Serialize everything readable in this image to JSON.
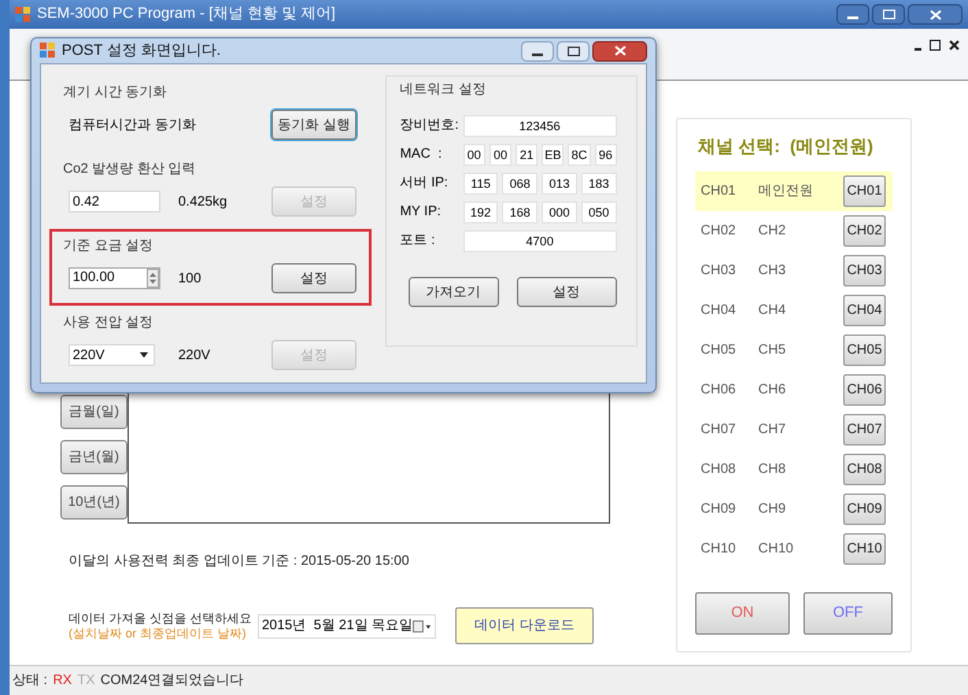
{
  "app": {
    "title": "SEM-3000 PC Program - [채널 현황 및 제어]"
  },
  "period_buttons": [
    "금월(일)",
    "금년(월)",
    "10년(년)"
  ],
  "update_notice": "이달의 사용전력 최종 업데이트 기준 : 2015-05-20 15:00",
  "download": {
    "prompt": "데이터 가져올 싯점을 선택하세요",
    "hint": "(설치날짜 or 최종업데이트 날짜)",
    "date": "2015년  5월 21일 목요일",
    "button": "데이터 다운로드"
  },
  "channel_panel": {
    "title": "채널 선택:  (메인전원)",
    "channels": [
      {
        "id": "CH01",
        "name": "메인전원",
        "button": "CH01",
        "selected": true
      },
      {
        "id": "CH02",
        "name": "CH2",
        "button": "CH02",
        "selected": false
      },
      {
        "id": "CH03",
        "name": "CH3",
        "button": "CH03",
        "selected": false
      },
      {
        "id": "CH04",
        "name": "CH4",
        "button": "CH04",
        "selected": false
      },
      {
        "id": "CH05",
        "name": "CH5",
        "button": "CH05",
        "selected": false
      },
      {
        "id": "CH06",
        "name": "CH6",
        "button": "CH06",
        "selected": false
      },
      {
        "id": "CH07",
        "name": "CH7",
        "button": "CH07",
        "selected": false
      },
      {
        "id": "CH08",
        "name": "CH8",
        "button": "CH08",
        "selected": false
      },
      {
        "id": "CH09",
        "name": "CH9",
        "button": "CH09",
        "selected": false
      },
      {
        "id": "CH10",
        "name": "CH10",
        "button": "CH10",
        "selected": false
      }
    ],
    "on_button": "ON",
    "off_button": "OFF"
  },
  "status_bar": {
    "label": "상태 :",
    "rx": {
      "text": "RX",
      "on": true
    },
    "tx": {
      "text": "TX",
      "on": false
    },
    "message": "COM24연결되었습니다"
  },
  "dialog": {
    "title": "POST 설정 화면입니다.",
    "groups": [
      {
        "kind": "sync",
        "title": "계기 시간 동기화",
        "label": "컴퓨터시간과 동기화",
        "button": {
          "label": "동기화 실행",
          "disabled": false,
          "focused": true
        },
        "highlighted": false
      },
      {
        "kind": "input",
        "title": "Co2 발생량 환산 입력",
        "value": "0.42",
        "reading": "0.425kg",
        "button": {
          "label": "설정",
          "disabled": true,
          "focused": false
        },
        "highlighted": false
      },
      {
        "kind": "spinner",
        "title": "기준 요금 설정",
        "value": "100.00",
        "reading": "100",
        "button": {
          "label": "설정",
          "disabled": false,
          "focused": false
        },
        "highlighted": true
      },
      {
        "kind": "select",
        "title": "사용 전압 설정",
        "value": "220V",
        "reading": "220V",
        "button": {
          "label": "설정",
          "disabled": true,
          "focused": false
        },
        "highlighted": false
      }
    ],
    "network": {
      "title": "네트워크 설정",
      "rows": [
        {
          "label": "장비번호:",
          "values": [
            "123456"
          ]
        },
        {
          "label": "MAC  :",
          "values": [
            "00",
            "00",
            "21",
            "EB",
            "8C",
            "96"
          ]
        },
        {
          "label": "서버 IP:",
          "values": [
            "115",
            "068",
            "013",
            "183"
          ]
        },
        {
          "label": "MY IP:",
          "values": [
            "192",
            "168",
            "000",
            "050"
          ]
        },
        {
          "label": "포트 :",
          "values": [
            "4700"
          ]
        }
      ],
      "buttons": [
        "가져오기",
        "설정"
      ]
    }
  }
}
